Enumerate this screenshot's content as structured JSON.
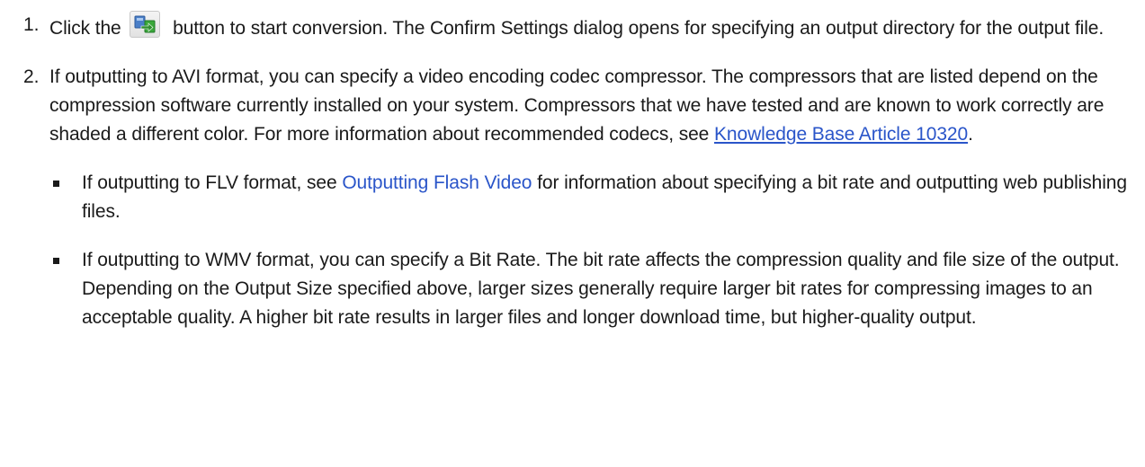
{
  "steps": [
    {
      "number": "1.",
      "text_before": "Click the",
      "icon": "convert-icon",
      "text_after": "button to start conversion. The Confirm Settings dialog opens for specifying an output directory for the output file."
    },
    {
      "number": "2.",
      "text": "If outputting to AVI format, you can specify a video encoding codec compressor. The compressors that are listed depend on the compression software currently installed on your system. Compressors that we have tested and are known to work correctly are shaded a different color. For more information about recommended codecs, see",
      "link_text": "Knowledge Base Article 10320",
      "link_suffix": "."
    }
  ],
  "bullets": [
    {
      "text_before": "If outputting to FLV format, see",
      "link_text": "Outputting Flash Video",
      "text_after": "for information about specifying a bit rate and outputting web publishing files."
    },
    {
      "text": "If outputting to WMV format, you can specify a Bit Rate. The bit rate affects the compression quality and file size of the output. Depending on the Output Size specified above, larger sizes generally require larger bit rates for compressing images to an acceptable quality. A higher bit rate results in larger files and longer download time, but higher-quality output."
    }
  ],
  "colors": {
    "text": "#1a1a1a",
    "link": "#2a55c9",
    "icon_blue": "#4a7fc8",
    "icon_green": "#3aa83a"
  }
}
